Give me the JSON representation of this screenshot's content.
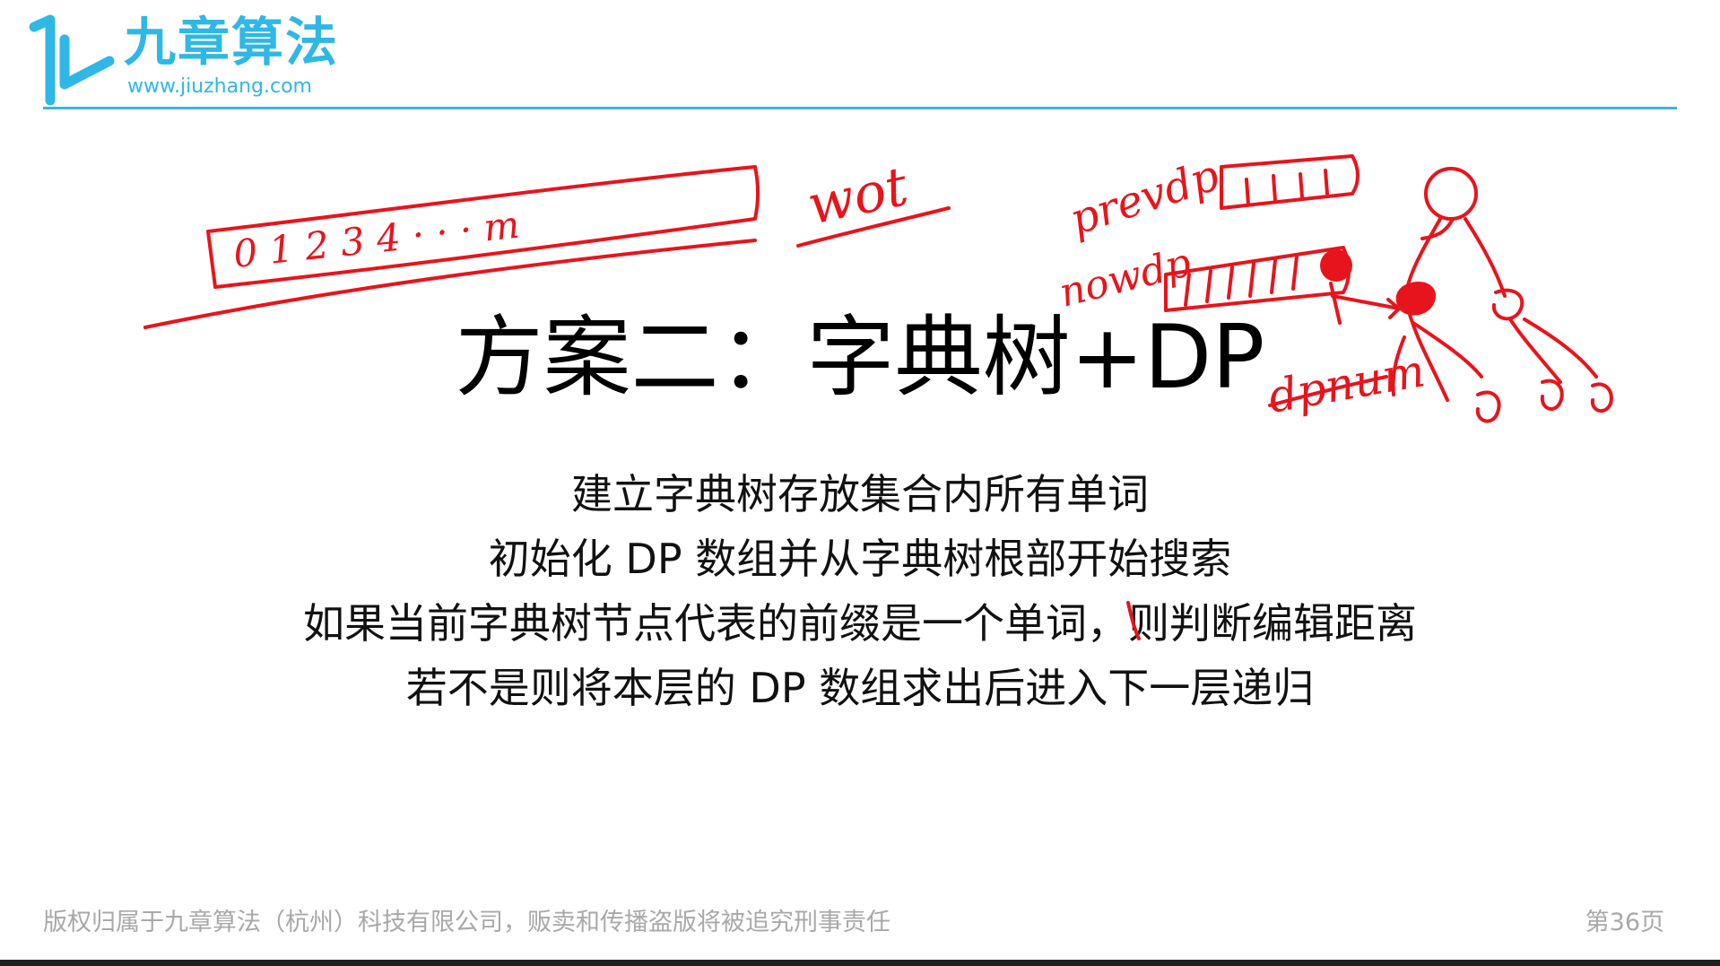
{
  "header": {
    "logo_name": "九章算法",
    "logo_url": "www.jiuzhang.com"
  },
  "slide": {
    "title": "方案二：字典树+DP",
    "lines": [
      "建立字典树存放集合内所有单词",
      "初始化 DP 数组并从字典树根部开始搜索",
      "如果当前字典树节点代表的前缀是一个单词，则判断编辑距离",
      "若不是则将本层的 DP 数组求出后进入下一层递归"
    ]
  },
  "annotations": {
    "array_label": "0 1 2 3 4 · · · m",
    "word_label": "wot",
    "prevdp_label": "prevdp",
    "nowdp_label": "nowdp",
    "dpnum_label": "dpnum",
    "ink_color": "#e8141c"
  },
  "footer": {
    "copyright": "版权归属于九章算法（杭州）科技有限公司，贩卖和传播盗版将被追究刑事责任",
    "page": "第36页"
  },
  "colors": {
    "brand": "#2fb7e6",
    "rule": "#3ab6de",
    "footer_text": "#a8a8a8",
    "title_text": "#000000"
  }
}
